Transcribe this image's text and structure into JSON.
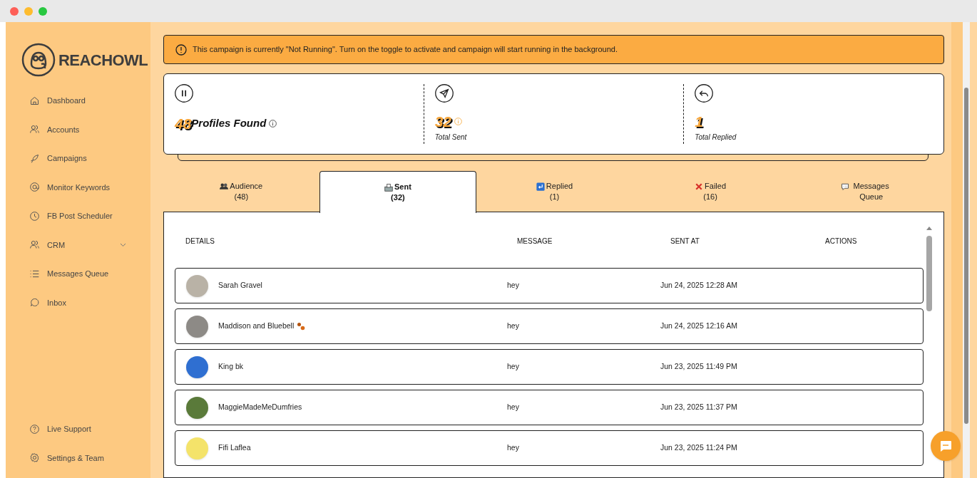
{
  "brand": "REACHOWL",
  "nav": [
    {
      "label": "Dashboard",
      "expandable": false
    },
    {
      "label": "Accounts",
      "expandable": false
    },
    {
      "label": "Campaigns",
      "expandable": false
    },
    {
      "label": "Monitor Keywords",
      "expandable": false
    },
    {
      "label": "FB Post Scheduler",
      "expandable": false
    },
    {
      "label": "CRM",
      "expandable": true
    },
    {
      "label": "Messages Queue",
      "expandable": false
    },
    {
      "label": "Inbox",
      "expandable": false
    }
  ],
  "nav_bottom": [
    {
      "label": "Live Support"
    },
    {
      "label": "Settings & Team"
    }
  ],
  "alert": {
    "text": "This campaign is currently \"Not Running\". Turn on the toggle to activate and campaign will start running in the background."
  },
  "stats": [
    {
      "value": "48",
      "label": "Profiles Found",
      "kind": "inline"
    },
    {
      "value": "32",
      "label": "Total Sent",
      "kind": "below"
    },
    {
      "value": "1",
      "label": "Total Replied",
      "kind": "below"
    }
  ],
  "tabs": [
    {
      "label": "Audience",
      "count": "(48)",
      "selected": false
    },
    {
      "label": "Sent",
      "count": "(32)",
      "selected": true
    },
    {
      "label": "Replied",
      "count": "(1)",
      "selected": false
    },
    {
      "label": "Failed",
      "count": "(16)",
      "selected": false
    },
    {
      "label": "Messages Queue",
      "selected": false
    }
  ],
  "table": {
    "columns": [
      "DETAILS",
      "MESSAGE",
      "SENT AT",
      "ACTIONS"
    ],
    "rows": [
      {
        "name": "Sarah Gravel",
        "message": "hey",
        "sent_at": "Jun 24, 2025 12:28 AM"
      },
      {
        "name": "Maddison and Bluebell",
        "message": "hey",
        "sent_at": "Jun 24, 2025 12:16 AM"
      },
      {
        "name": "King bk",
        "message": "hey",
        "sent_at": "Jun 23, 2025 11:49 PM"
      },
      {
        "name": "MaggieMadeMeDumfries",
        "message": "hey",
        "sent_at": "Jun 23, 2025 11:37 PM"
      },
      {
        "name": "Fifi Laflea",
        "message": "hey",
        "sent_at": "Jun 23, 2025 11:24 PM"
      }
    ]
  }
}
